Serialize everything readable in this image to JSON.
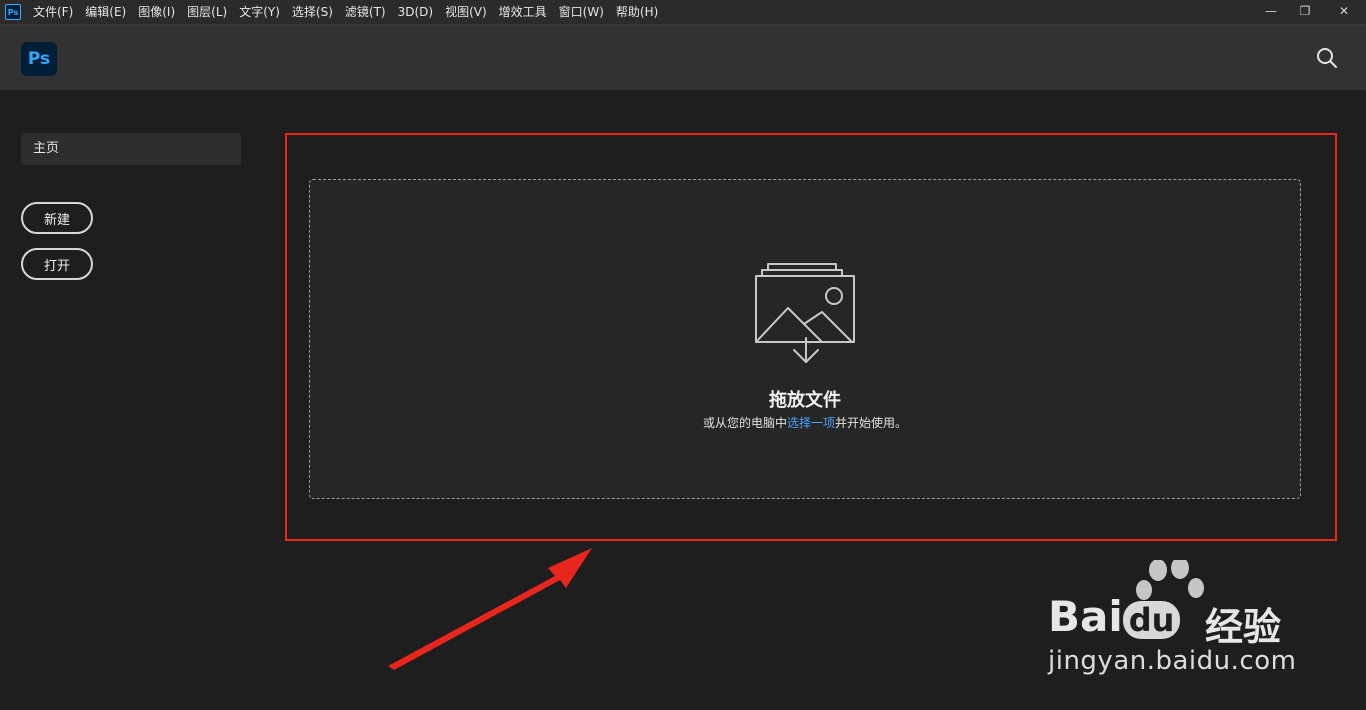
{
  "menubar": {
    "app_icon_text": "Ps",
    "items": [
      "文件(F)",
      "编辑(E)",
      "图像(I)",
      "图层(L)",
      "文字(Y)",
      "选择(S)",
      "滤镜(T)",
      "3D(D)",
      "视图(V)",
      "增效工具",
      "窗口(W)",
      "帮助(H)"
    ],
    "window_controls": [
      "—",
      "❐",
      "✕"
    ]
  },
  "header": {
    "logo_text": "Ps",
    "search_icon": "search-icon"
  },
  "sidebar": {
    "home_label": "主页",
    "new_label": "新建",
    "open_label": "打开"
  },
  "dropzone": {
    "title": "拖放文件",
    "subtitle_before": "或从您的电脑中",
    "subtitle_link": "选择一项",
    "subtitle_after": "并开始使用。",
    "icon": "image-drop-icon"
  },
  "watermark": {
    "brand_latin": "Bai",
    "brand_du": "du",
    "brand_cn": "经验",
    "url": "jingyan.baidu.com"
  },
  "colors": {
    "highlight": "#e8261d",
    "link": "#4aa3ff",
    "ps_blue": "#31a8ff",
    "ps_dark": "#001e36"
  }
}
